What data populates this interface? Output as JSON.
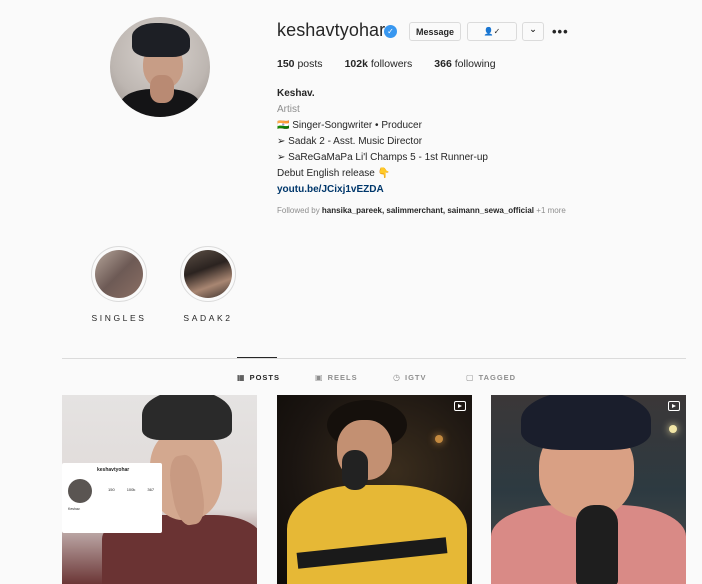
{
  "profile": {
    "username": "keshavtyohar",
    "verified_icon": "verified-badge-icon",
    "buttons": {
      "message": "Message",
      "following_icon": "person-check-icon",
      "following_symbol": "👤✓",
      "chevron": "⌄",
      "more": "•••"
    },
    "stats": [
      {
        "value": "150",
        "label": "posts"
      },
      {
        "value": "102k",
        "label": "followers"
      },
      {
        "value": "366",
        "label": "following"
      }
    ],
    "bio": {
      "name": "Keshav.",
      "category": "Artist",
      "lines": [
        "🇮🇳 Singer-Songwriter • Producer",
        "➢ Sadak 2 - Asst. Music Director",
        "➢ SaReGaMaPa Li'l Champs 5 - 1st Runner-up",
        "Debut English release 👇"
      ],
      "link": "youtu.be/JCixj1vEZDA"
    },
    "followed_by": {
      "prefix": "Followed by",
      "names": "hansika_pareek, salimmerchant, saimann_sewa_official",
      "more": "+1 more"
    }
  },
  "highlights": [
    {
      "label": "SINGLES"
    },
    {
      "label": "SADAK2"
    }
  ],
  "tabs": [
    {
      "label": "POSTS",
      "icon": "grid-icon",
      "glyph": "▦",
      "active": true
    },
    {
      "label": "REELS",
      "icon": "reels-icon",
      "glyph": "▣",
      "active": false
    },
    {
      "label": "IGTV",
      "icon": "igtv-icon",
      "glyph": "◷",
      "active": false
    },
    {
      "label": "TAGGED",
      "icon": "tagged-icon",
      "glyph": "▢",
      "active": false
    }
  ],
  "post1_card": {
    "username": "keshavtyohar",
    "stats": [
      "150",
      "100k",
      "367"
    ],
    "name": "Keshav."
  },
  "colors": {
    "background": "#fafafa",
    "text": "#262626",
    "muted": "#8e8e8e",
    "link": "#00376b",
    "verified": "#3897f0",
    "border": "#dbdbdb"
  }
}
